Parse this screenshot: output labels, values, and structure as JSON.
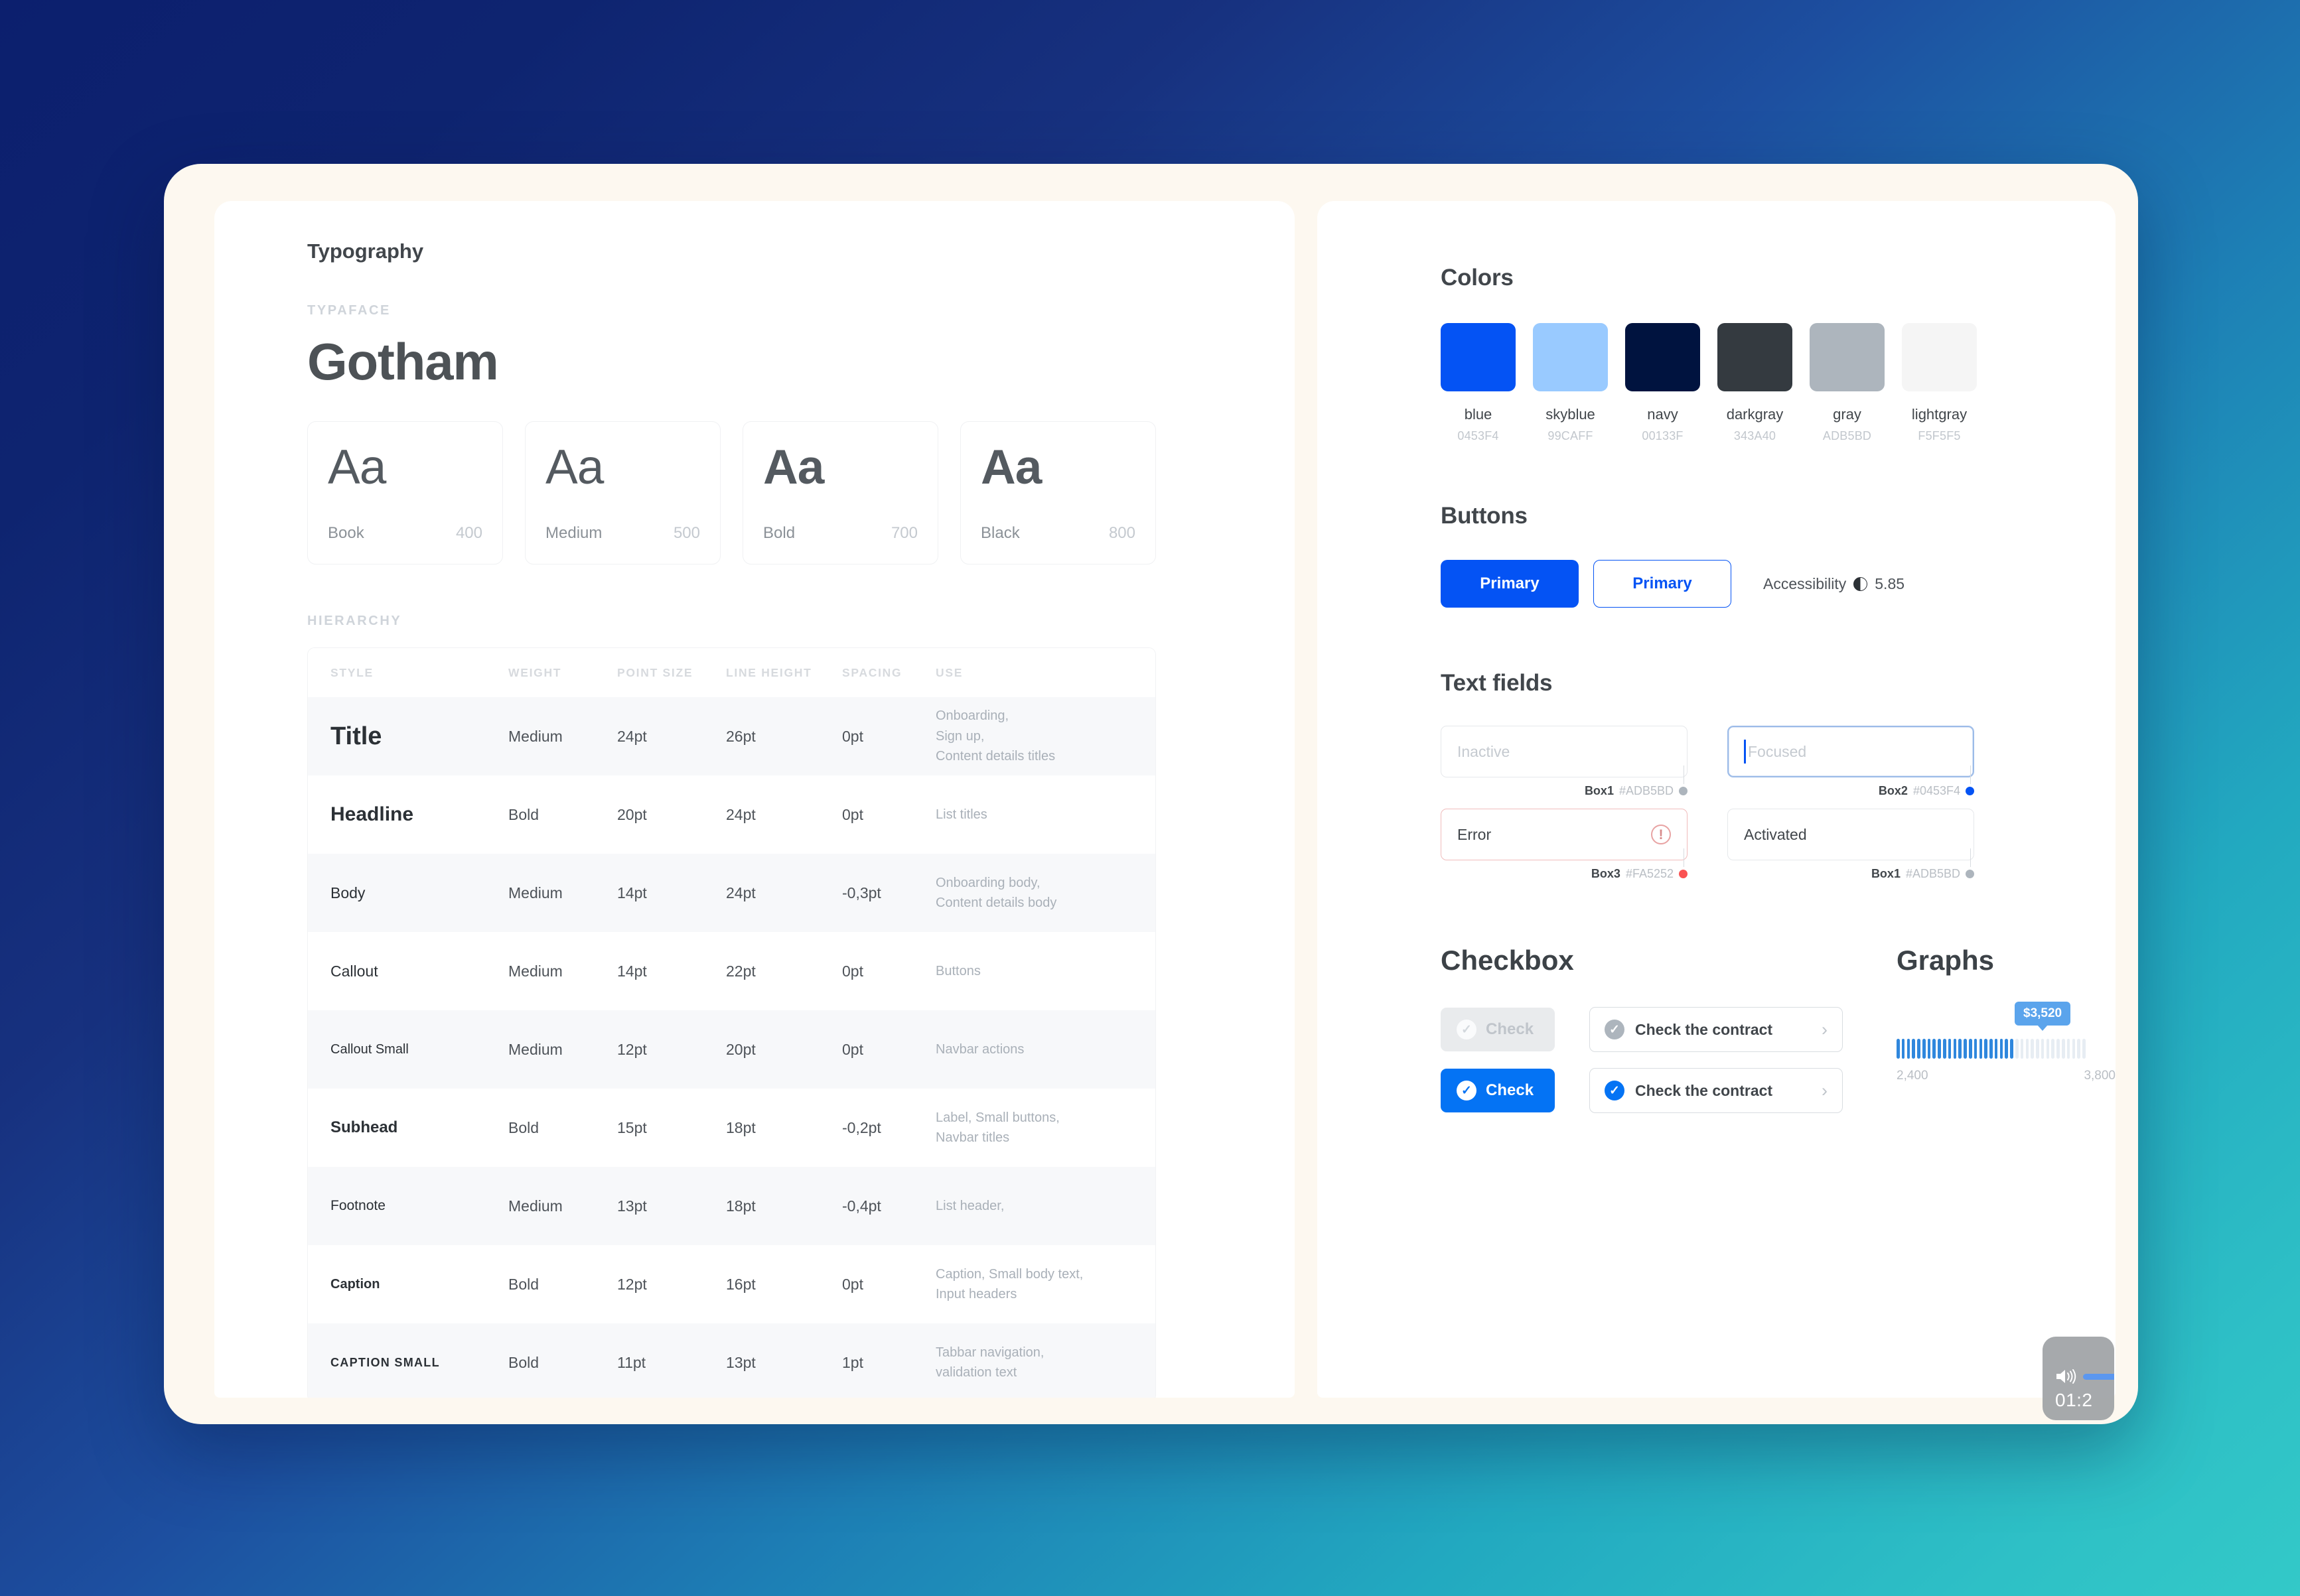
{
  "typography": {
    "heading": "Typography",
    "typeface_eyebrow": "TYPAFACE",
    "typeface_name": "Gotham",
    "weights": [
      {
        "sample": "Aa",
        "name": "Book",
        "value": "400"
      },
      {
        "sample": "Aa",
        "name": "Medium",
        "value": "500"
      },
      {
        "sample": "Aa",
        "name": "Bold",
        "value": "700"
      },
      {
        "sample": "Aa",
        "name": "Black",
        "value": "800"
      }
    ],
    "hierarchy_eyebrow": "HIERARCHY",
    "table": {
      "headers": [
        "STYLE",
        "WEIGHT",
        "POINT SIZE",
        "LINE HEIGHT",
        "SPACING",
        "USE"
      ],
      "rows": [
        {
          "style": "Title",
          "weight": "Medium",
          "size": "24pt",
          "line_height": "26pt",
          "spacing": "0pt",
          "use": "Onboarding,\nSign up,\nContent details titles"
        },
        {
          "style": "Headline",
          "weight": "Bold",
          "size": "20pt",
          "line_height": "24pt",
          "spacing": "0pt",
          "use": "List titles"
        },
        {
          "style": "Body",
          "weight": "Medium",
          "size": "14pt",
          "line_height": "24pt",
          "spacing": "-0,3pt",
          "use": "Onboarding body,\nContent details body"
        },
        {
          "style": "Callout",
          "weight": "Medium",
          "size": "14pt",
          "line_height": "22pt",
          "spacing": "0pt",
          "use": "Buttons"
        },
        {
          "style": "Callout Small",
          "weight": "Medium",
          "size": "12pt",
          "line_height": "20pt",
          "spacing": "0pt",
          "use": "Navbar actions"
        },
        {
          "style": "Subhead",
          "weight": "Bold",
          "size": "15pt",
          "line_height": "18pt",
          "spacing": "-0,2pt",
          "use": "Label, Small buttons,\nNavbar titles"
        },
        {
          "style": "Footnote",
          "weight": "Medium",
          "size": "13pt",
          "line_height": "18pt",
          "spacing": "-0,4pt",
          "use": "List header,"
        },
        {
          "style": "Caption",
          "weight": "Bold",
          "size": "12pt",
          "line_height": "16pt",
          "spacing": "0pt",
          "use": "Caption, Small body text,\nInput headers"
        },
        {
          "style": "CAPTION SMALL",
          "weight": "Bold",
          "size": "11pt",
          "line_height": "13pt",
          "spacing": "1pt",
          "use": "Tabbar navigation,\nvalidation text"
        }
      ]
    }
  },
  "colors": {
    "heading": "Colors",
    "swatches": [
      {
        "name": "blue",
        "hex_label": "0453F4",
        "hex": "#0453F4"
      },
      {
        "name": "skyblue",
        "hex_label": "99CAFF",
        "hex": "#99CAFF"
      },
      {
        "name": "navy",
        "hex_label": "00133F",
        "hex": "#00133F"
      },
      {
        "name": "darkgray",
        "hex_label": "343A40",
        "hex": "#343A40"
      },
      {
        "name": "gray",
        "hex_label": "ADB5BD",
        "hex": "#ADB5BD"
      },
      {
        "name": "lightgray",
        "hex_label": "F5F5F5",
        "hex": "#F5F5F5"
      }
    ]
  },
  "buttons": {
    "heading": "Buttons",
    "filled_label": "Primary",
    "outline_label": "Primary",
    "accessibility_label": "Accessibility",
    "accessibility_value": "5.85"
  },
  "text_fields": {
    "heading": "Text fields",
    "fields": [
      {
        "value": "Inactive",
        "state": "inactive",
        "meta_label": "Box1",
        "meta_hex": "#ADB5BD",
        "dot": "#ADB5BD"
      },
      {
        "value": "Focused",
        "state": "focused",
        "meta_label": "Box2",
        "meta_hex": "#0453F4",
        "dot": "#0453F4"
      },
      {
        "value": "Error",
        "state": "error",
        "meta_label": "Box3",
        "meta_hex": "#FA5252",
        "dot": "#FA5252"
      },
      {
        "value": "Activated",
        "state": "activated",
        "meta_label": "Box1",
        "meta_hex": "#ADB5BD",
        "dot": "#ADB5BD"
      }
    ]
  },
  "checkbox": {
    "heading": "Checkbox",
    "pill_off_label": "Check",
    "pill_on_label": "Check",
    "row_off_label": "Check the contract",
    "row_on_label": "Check the contract",
    "check_glyph": "✓",
    "chevron_glyph": "›"
  },
  "graphs": {
    "heading": "Graphs"
  },
  "chart_data": {
    "type": "bar",
    "title": "Graphs",
    "tooltip_label": "$3,520",
    "value": 3520,
    "min": 2400,
    "max": 3800,
    "min_label": "2,400",
    "max_label": "3,800",
    "total_ticks": 37,
    "filled_ticks": 23,
    "filled_color": "#2F87DD",
    "empty_color": "#E7EDF3",
    "xlabel": "",
    "ylabel": "",
    "grid": false,
    "legend": "none"
  },
  "video_overlay": {
    "timestamp": "01:2",
    "volume_percent": 100
  }
}
